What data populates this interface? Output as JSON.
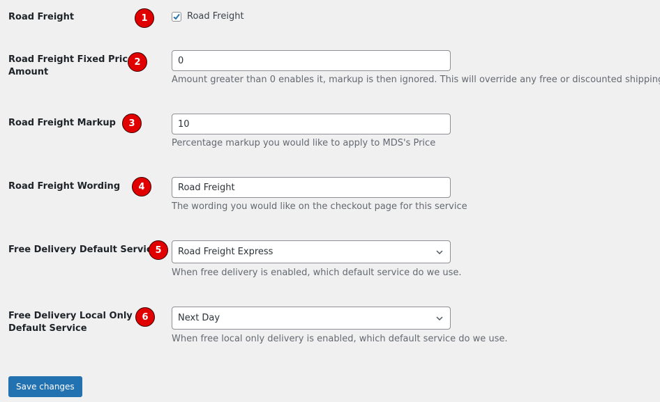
{
  "settings": {
    "road_freight": {
      "label": "Road Freight",
      "badge": "1",
      "checkbox_label": "Road Freight",
      "checked": true
    },
    "fixed_price": {
      "label_line1": "Road Freight Fixed Price",
      "label_line2": "Amount",
      "badge": "2",
      "value": "0",
      "description": "Amount greater than 0 enables it, markup is then ignored. This will override any free or discounted shipping"
    },
    "markup": {
      "label": "Road Freight Markup",
      "badge": "3",
      "value": "10",
      "description": "Percentage markup you would like to apply to MDS's Price"
    },
    "wording": {
      "label": "Road Freight Wording",
      "badge": "4",
      "value": "Road Freight",
      "description": "The wording you would like on the checkout page for this service"
    },
    "free_default_service": {
      "label": "Free Delivery Default Service",
      "badge": "5",
      "selected": "Road Freight Express",
      "description": "When free delivery is enabled, which default service do we use."
    },
    "free_local_default_service": {
      "label_line1": "Free Delivery Local Only",
      "label_line2": "Default Service",
      "badge": "6",
      "selected": "Next Day",
      "description": "When free local only delivery is enabled, which default service do we use."
    }
  },
  "actions": {
    "save_label": "Save changes"
  },
  "colors": {
    "primary": "#2271b1",
    "badge": "#e00000",
    "background": "#f0f0f1"
  }
}
